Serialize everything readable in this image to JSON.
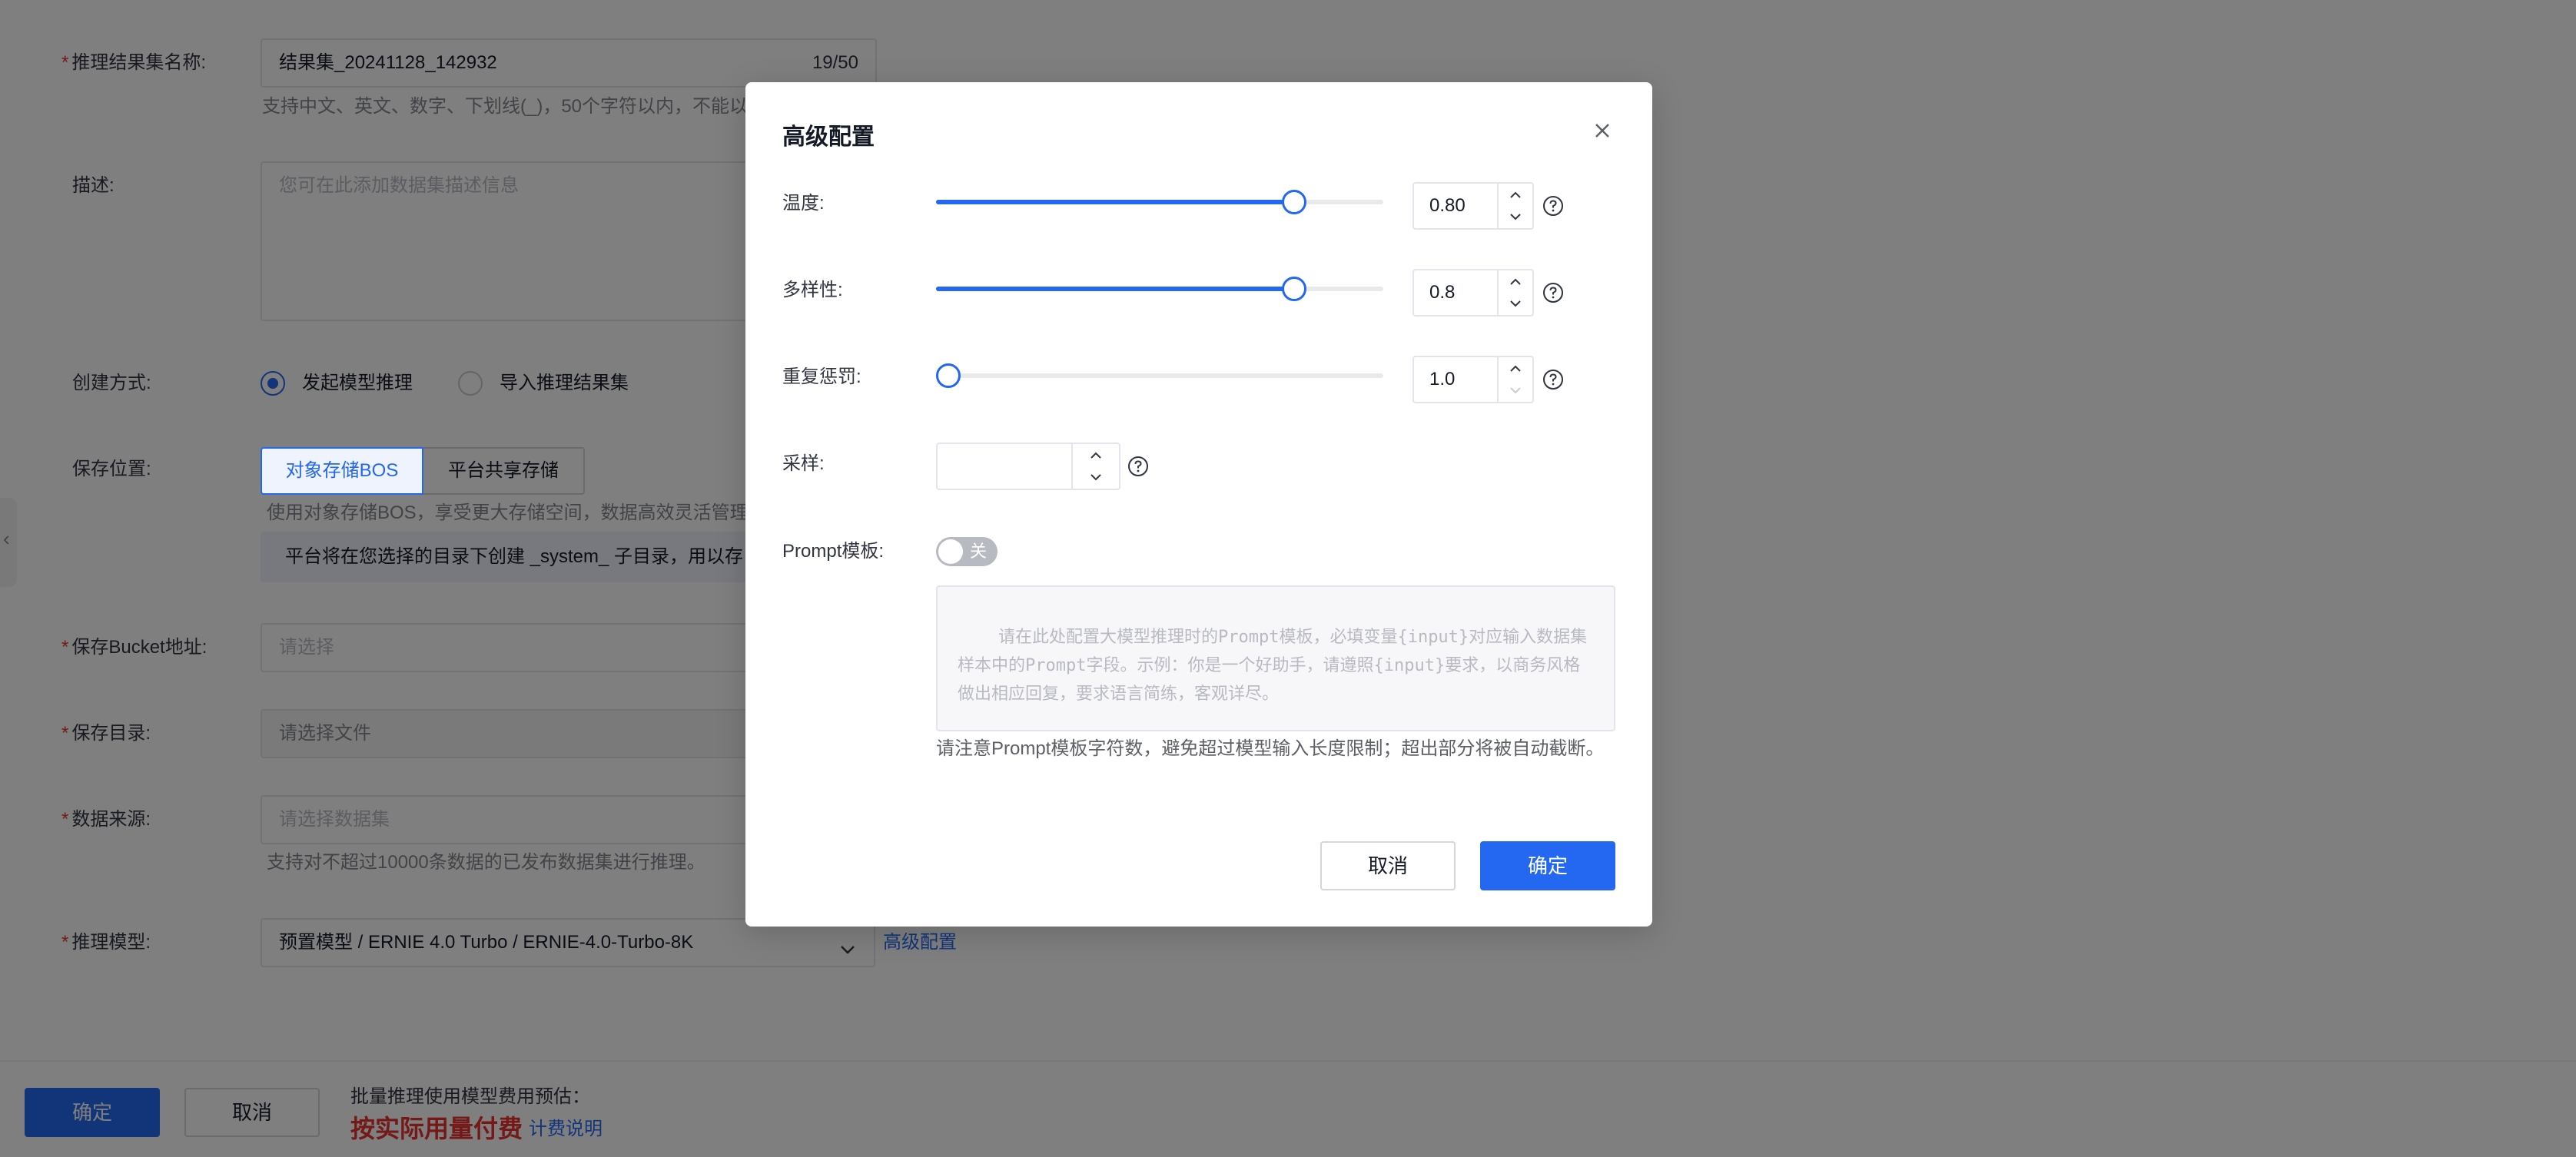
{
  "background_form": {
    "name_label": "推理结果集名称:",
    "name_value": "结果集_20241128_142932",
    "name_count": "19/50",
    "name_hint": "支持中文、英文、数字、下划线(_)，50个字符以内，不能以",
    "desc_label": "描述:",
    "desc_placeholder": "您可在此添加数据集描述信息",
    "create_label": "创建方式:",
    "create_option_1": "发起模型推理",
    "create_option_2": "导入推理结果集",
    "save_label": "保存位置:",
    "save_option_1": "对象存储BOS",
    "save_option_2": "平台共享存储",
    "save_hint": "使用对象存储BOS，享受更大存储空间，数据高效灵活管理",
    "save_notice": "平台将在您选择的目录下创建 _system_ 子目录，用以存",
    "bucket_label": "保存Bucket地址:",
    "bucket_placeholder": "请选择",
    "dir_label": "保存目录:",
    "dir_placeholder": "请选择文件",
    "source_label": "数据来源:",
    "source_placeholder": "请选择数据集",
    "source_hint": "支持对不超过10000条数据的已发布数据集进行推理。",
    "model_label": "推理模型:",
    "model_value": "预置模型 / ERNIE 4.0 Turbo / ERNIE-4.0-Turbo-8K",
    "advanced_link": "高级配置"
  },
  "footer": {
    "confirm": "确定",
    "cancel": "取消",
    "cost_label": "批量推理使用模型费用预估：",
    "cost_value": "按实际用量付费",
    "billing_link": "计费说明"
  },
  "dialog": {
    "title": "高级配置",
    "temperature_label": "温度:",
    "temperature_value": "0.80",
    "temperature_level": 0.8,
    "diversity_label": "多样性:",
    "diversity_value": "0.8",
    "diversity_level": 0.8,
    "penalty_label": "重复惩罚:",
    "penalty_value": "1.0",
    "penalty_level": 0.0,
    "sampling_label": "采样:",
    "sampling_value": "",
    "prompt_label": "Prompt模板:",
    "prompt_toggle": "关",
    "prompt_placeholder": "请在此处配置大模型推理时的Prompt模板，必填变量{input}对应输入数据集样本中的Prompt字段。示例：你是一个好助手，请遵照{input}要求，以商务风格做出相应回复，要求语言简练，客观详尽。",
    "prompt_hint": "请注意Prompt模板字符数，避免超过模型输入长度限制；超出部分将被自动截断。",
    "cancel": "取消",
    "confirm": "确定"
  },
  "colors": {
    "primary": "#2468f2",
    "required": "#e8322e",
    "cost_red": "#e8322e"
  },
  "icons": {
    "close": "close-icon",
    "help": "question-circle-icon",
    "chevron_down": "chevron-down-icon",
    "stepper_up": "chevron-up-icon",
    "stepper_down": "chevron-down-icon"
  }
}
